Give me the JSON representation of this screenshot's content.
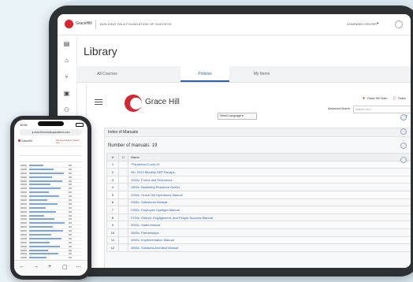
{
  "app": {
    "brand": "GraceHill",
    "tagline": "BUILDING ON A FOUNDATION OF SUCCESS",
    "learning_center": "LEARNING CENTER",
    "caret": "▾",
    "page_title": "Library"
  },
  "rail_icons": [
    "document-icon",
    "home-icon",
    "graph-icon",
    "gallery-icon",
    "team-icon",
    "calendar-icon"
  ],
  "tabs": [
    {
      "label": "All Courses",
      "active": false
    },
    {
      "label": "Policies",
      "active": true
    },
    {
      "label": "My Items",
      "active": false
    }
  ],
  "policy": {
    "logo_text": "Grace Hill",
    "language_select": "Select Language ▾",
    "adv_search": "Advanced Search",
    "search_placeholder": "Search here",
    "team1": "Grace Hill Team",
    "team2": "Grace",
    "help": "Help",
    "index_title": "Index of Manuals",
    "num_manuals": "Number of manuals: 19",
    "col_num": "#",
    "col_chk": "☐",
    "col_name": "Name",
    "rows": [
      {
        "n": "1",
        "name": "*Pandemic/Covid-19"
      },
      {
        "n": "2",
        "name": "0/b. 2022 Monthly SEP Recaps"
      },
      {
        "n": "3",
        "name": "1000c. Forms and Resources"
      },
      {
        "n": "4",
        "name": "1500c. Marketing Resource Center"
      },
      {
        "n": "5",
        "name": "2000c. Grace Hill Operations Manual"
      },
      {
        "n": "6",
        "name": "2300c. Salesforce Manual"
      },
      {
        "n": "7",
        "name": "2350c. Employee Spotlight Manual"
      },
      {
        "n": "8",
        "name": "2700c. Culture, Engagement, and People Success Manual"
      },
      {
        "n": "9",
        "name": "3000c. Sales Manual"
      },
      {
        "n": "10",
        "name": "3500c. Partnerships"
      },
      {
        "n": "11",
        "name": "4000c. Implementation Manual"
      },
      {
        "n": "12",
        "name": "4500c. Solutions Architect Manual"
      }
    ]
  },
  "phone": {
    "time": "10:51",
    "url": "● ecici.thecrestequindaion.com",
    "logo": "GraceHill",
    "adv": "Advanced Search | Search here"
  },
  "colors": {
    "brand_red": "#d8262e",
    "link_blue": "#2a63b8",
    "tablet_frame": "#2e3134",
    "background": "#e9f2f7"
  }
}
